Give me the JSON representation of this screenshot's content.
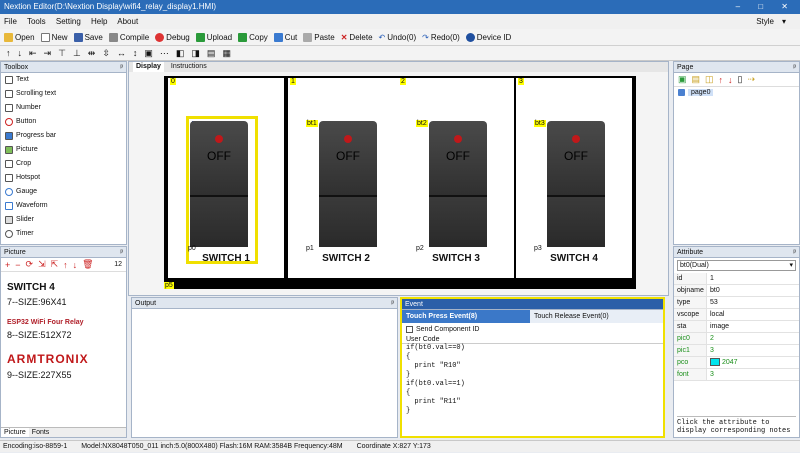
{
  "title": "Nextion Editor(D:\\Nextion Display\\wifi4_relay_display1.HMI)",
  "menu": {
    "file": "File",
    "tools": "Tools",
    "setting": "Setting",
    "help": "Help",
    "about": "About",
    "style": "Style"
  },
  "toolbar": {
    "open": "Open",
    "new": "New",
    "save": "Save",
    "compile": "Compile",
    "debug": "Debug",
    "upload": "Upload",
    "copy": "Copy",
    "cut": "Cut",
    "paste": "Paste",
    "delete": "Delete",
    "undo": "Undo(0)",
    "redo": "Redo(0)",
    "device": "Device",
    "id": "ID"
  },
  "toolbox": {
    "title": "Toolbox",
    "items": [
      "Text",
      "Scrolling text",
      "Number",
      "Button",
      "Progress bar",
      "Picture",
      "Crop",
      "Hotspot",
      "Gauge",
      "Waveform",
      "Slider",
      "Timer"
    ]
  },
  "picture": {
    "title": "Picture",
    "count": "12",
    "items": [
      {
        "title": "SWITCH 4",
        "caption": "7--SIZE:96X41"
      },
      {
        "title": "ESP32 WiFi Four Relay",
        "caption": "8--SIZE:512X72"
      },
      {
        "title": "ARMTRONIX",
        "caption": "9--SIZE:227X55"
      }
    ],
    "tabs": [
      "Picture",
      "Fonts"
    ]
  },
  "canvas": {
    "tabs": [
      "Display",
      "Instructions"
    ],
    "switches": [
      {
        "tag": "bt0",
        "ptag": "p0",
        "label": "SWITCH 1",
        "state": "OFF",
        "slot": "0"
      },
      {
        "tag": "bt1",
        "ptag": "p1",
        "label": "SWITCH 2",
        "state": "OFF",
        "slot": "1"
      },
      {
        "tag": "bt2",
        "ptag": "p2",
        "label": "SWITCH 3",
        "state": "OFF",
        "slot": "2"
      },
      {
        "tag": "bt3",
        "ptag": "p3",
        "label": "SWITCH 4",
        "state": "OFF",
        "slot": "3"
      }
    ],
    "corner_tag": "p5"
  },
  "output": {
    "title": "Output"
  },
  "event": {
    "title": "Event",
    "tab_press": "Touch Press Event(8)",
    "tab_release": "Touch Release Event(0)",
    "send_component": "Send Component ID",
    "user_code": "User Code",
    "code": "if(bt0.val==0)\n{\n  print \"R10\"\n}\nif(bt0.val==1)\n{\n  print \"R11\"\n}"
  },
  "page": {
    "title": "Page",
    "item": "page0"
  },
  "attribute": {
    "title": "Attribute",
    "selected": "bt0(Dual)",
    "rows": [
      {
        "k": "id",
        "v": "1"
      },
      {
        "k": "objname",
        "v": "bt0"
      },
      {
        "k": "type",
        "v": "53"
      },
      {
        "k": "vscope",
        "v": "local"
      },
      {
        "k": "sta",
        "v": "image"
      },
      {
        "k": "pic0",
        "v": "2"
      },
      {
        "k": "pic1",
        "v": "3"
      },
      {
        "k": "pco",
        "v": "2047"
      },
      {
        "k": "font",
        "v": "3"
      }
    ],
    "note": "Click the attribute to display corresponding notes"
  },
  "status": {
    "encoding": "Encoding:iso-8859-1",
    "model": "Model:NX8048T050_011  inch:5.0(800X480)  Flash:16M  RAM:3584B  Frequency:48M",
    "coord": "Coordinate X:827  Y:173"
  },
  "colors": {
    "accent": "#2b6cb8",
    "highlight": "#f0e000",
    "pco": "#00e5ee"
  }
}
